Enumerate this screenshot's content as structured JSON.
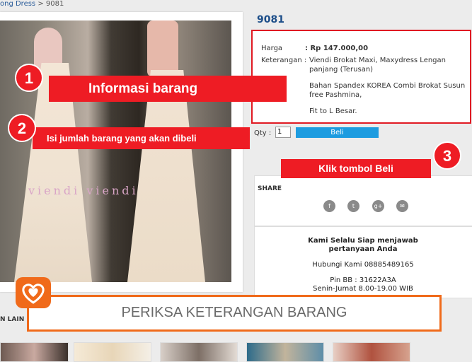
{
  "breadcrumb": {
    "parent": "ong Dress",
    "separator": ">",
    "current": "9081"
  },
  "product": {
    "title": "9081",
    "watermark": "viendi  viendi",
    "harga_label": "Harga",
    "harga_value": ": Rp 147.000,00",
    "keterangan_label": "Keterangan :",
    "keterangan_line1": "Viendi Brokat Maxi, Maxydress  Lengan",
    "keterangan_line2": "panjang (Terusan)",
    "keterangan_line3": "Bahan Spandex KOREA Combi Brokat Susun",
    "keterangan_line4": "free Pashmina,",
    "keterangan_line5": "Fit to L Besar."
  },
  "purchase": {
    "qty_label": "Qty :",
    "qty_value": "1",
    "buy_label": "Beli"
  },
  "share": {
    "label": "SHARE",
    "icons": [
      "facebook-icon",
      "twitter-icon",
      "google-plus-icon",
      "email-icon"
    ],
    "glyphs": [
      "f",
      "t",
      "g+",
      "✉"
    ]
  },
  "contact": {
    "line1": "Kami Selalu Siap menjawab",
    "line2": "pertanyaan Anda",
    "line3": "Hubungi Kami 08885489165",
    "line4": "Pin BB : 31622A3A",
    "line5": "Senin-Jumat 8.00-19.00 WIB"
  },
  "callouts": {
    "step1_number": "1",
    "step1_text": "Informasi barang",
    "step2_number": "2",
    "step2_text": "Isi jumlah barang yang akan dibeli",
    "step3_number": "3",
    "step3_text": "Klik tombol Beli",
    "check_text": "PERIKSA KETERANGAN BARANG"
  },
  "related": {
    "label": "N LAIN"
  },
  "colors": {
    "accent_red": "#ee1c24",
    "link_blue": "#1d4e89",
    "buy_blue": "#1d9ce0",
    "orange": "#f06a1a"
  }
}
